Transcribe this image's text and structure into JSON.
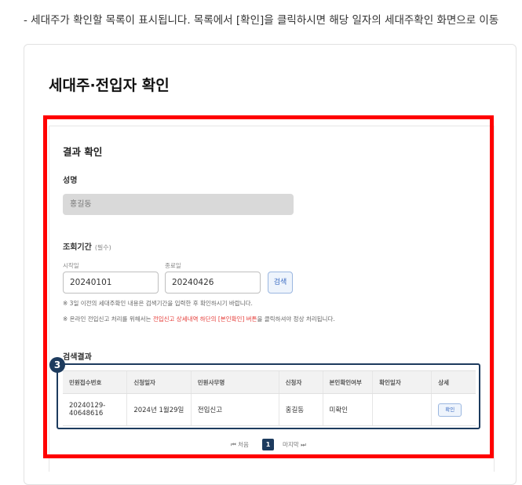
{
  "top_note": "- 세대주가 확인할 목록이 표시됩니다. 목록에서 [확인]을 클릭하시면 해당 일자의 세대주확인 화면으로 이동",
  "page_title": "세대주·전입자 확인",
  "section_title": "결과 확인",
  "name": {
    "label": "성명",
    "value": "홍길동"
  },
  "period": {
    "label": "조회기간",
    "required": "(필수)",
    "start_label": "시작일",
    "start_value": "20240101",
    "end_label": "종료일",
    "end_value": "20240426",
    "search_button": "검색"
  },
  "notes": {
    "note1": "※ 3일 이전의 세대주확인 내용은 검색기간을 입력한 후 확인하시기 바랍니다.",
    "note2_prefix": "※ 온라인 전입신고 처리를 위해서는 ",
    "note2_highlight": "전입신고 상세내역 하단의 [본인확인] 버튼",
    "note2_suffix": "을 클릭하셔야 정상 처리됩니다."
  },
  "results": {
    "title": "검색결과",
    "badge": "3",
    "headers": [
      "민원접수번호",
      "신청일자",
      "민원사무명",
      "신청자",
      "본인확인여부",
      "확인일자",
      "상세"
    ],
    "rows": [
      {
        "receipt_no_line1": "20240129-",
        "receipt_no_line2": "40648616",
        "date": "2024년 1월29일",
        "service": "전입신고",
        "applicant": "홍길동",
        "verified": "미확인",
        "confirm_date": "",
        "detail_button": "확인"
      }
    ]
  },
  "pagination": {
    "first": "처음",
    "current": "1",
    "last": "마지막"
  },
  "colors": {
    "highlight": "#ff0000",
    "accent_navy": "#1d3b5e",
    "note_red": "#e53935"
  }
}
